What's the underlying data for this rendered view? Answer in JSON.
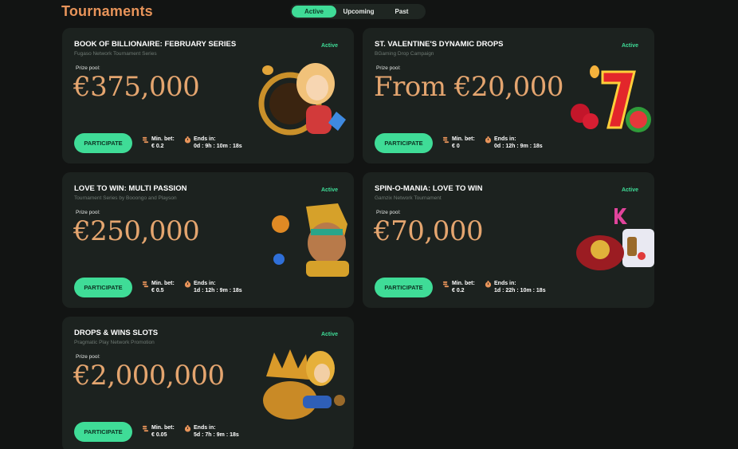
{
  "page": {
    "title": "Tournaments"
  },
  "tabs": [
    {
      "label": "Active",
      "selected": true
    },
    {
      "label": "Upcoming",
      "selected": false
    },
    {
      "label": "Past",
      "selected": false
    }
  ],
  "labels": {
    "prize_pool": "Prize pool:",
    "min_bet": "Min. bet:",
    "ends_in": "Ends in:",
    "participate": "PARTICIPATE"
  },
  "colors": {
    "accent": "#3fdc97",
    "title": "#e8945a",
    "prize": "#e4a56f",
    "card": "#1c221f",
    "background": "#121413"
  },
  "tournaments": [
    {
      "title": "BOOK OF BILLIONAIRE: FEBRUARY SERIES",
      "subtitle": "Fugaso Network Tournament Series",
      "status": "Active",
      "prize": "€375,000",
      "min_bet": "€ 0.2",
      "ends_in": "0d : 9h : 10m : 18s",
      "art": "gold-woman-art"
    },
    {
      "title": "ST. VALENTINE'S DYNAMIC DROPS",
      "subtitle": "BGaming Drop Campaign",
      "status": "Active",
      "prize": "From €20,000",
      "min_bet": "€ 0",
      "ends_in": "0d : 12h : 9m : 18s",
      "art": "fruit-seven-art"
    },
    {
      "title": "LOVE TO WIN: MULTI PASSION",
      "subtitle": "Tournament Series by Booongo and Playson",
      "status": "Active",
      "prize": "€250,000",
      "min_bet": "€ 0.5",
      "ends_in": "1d : 12h : 9m : 18s",
      "art": "aztec-warrior-art"
    },
    {
      "title": "SPIN-O-MANIA: LOVE TO WIN",
      "subtitle": "Gamzix Network Tournament",
      "status": "Active",
      "prize": "€70,000",
      "min_bet": "€ 0.2",
      "ends_in": "1d : 22h : 10m : 18s",
      "art": "slot-symbols-art"
    },
    {
      "title": "DROPS & WINS SLOTS",
      "subtitle": "Pragmatic Play Network Promotion",
      "status": "Active",
      "prize": "€2,000,000",
      "min_bet": "€ 0.05",
      "ends_in": "5d : 7h : 9m : 18s",
      "art": "drops-wins-art"
    }
  ]
}
